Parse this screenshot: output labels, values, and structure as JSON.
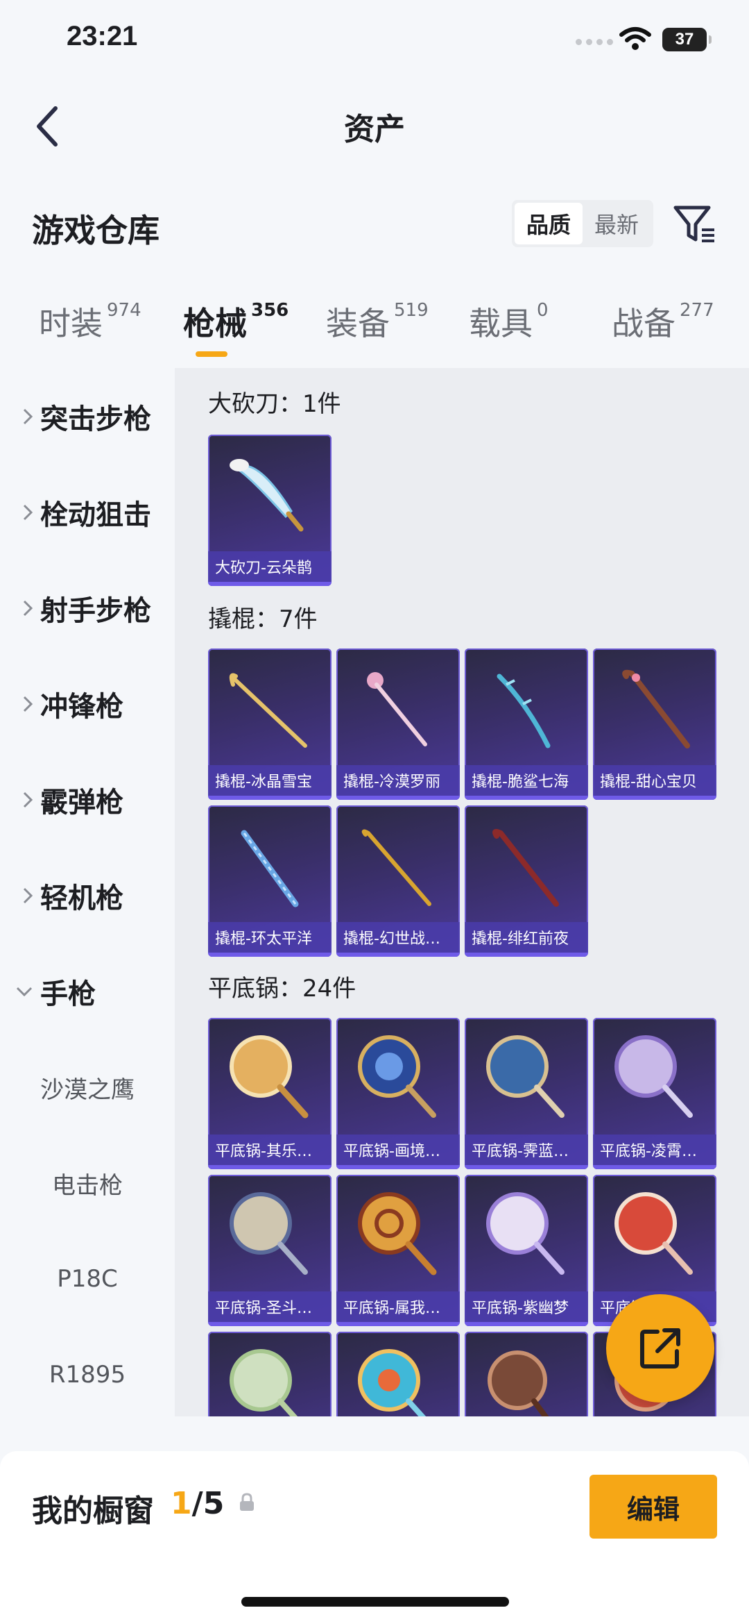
{
  "status_bar": {
    "time": "23:21",
    "battery": "37"
  },
  "header": {
    "title": "资产"
  },
  "warehouse": {
    "title": "游戏仓库",
    "sort_options": [
      "品质",
      "最新"
    ]
  },
  "tabs": [
    {
      "label": "时装",
      "count": "974"
    },
    {
      "label": "枪械",
      "count": "356"
    },
    {
      "label": "装备",
      "count": "519"
    },
    {
      "label": "载具",
      "count": "0"
    },
    {
      "label": "战备",
      "count": "277"
    }
  ],
  "sidebar": {
    "categories": [
      "突击步枪",
      "栓动狙击",
      "射手步枪",
      "冲锋枪",
      "霰弹枪",
      "轻机枪",
      "手枪"
    ],
    "sub_items": [
      "沙漠之鹰",
      "电击枪",
      "P18C",
      "R1895"
    ]
  },
  "groups": [
    {
      "title": "大砍刀：1件",
      "items": [
        "大砍刀-云朵鹊"
      ]
    },
    {
      "title": "撬棍：7件",
      "items": [
        "撬棍-冰晶雪宝",
        "撬棍-冷漠罗丽",
        "撬棍-脆鲨七海",
        "撬棍-甜心宝贝",
        "撬棍-环太平洋",
        "撬棍-幻世战…",
        "撬棍-绯红前夜"
      ]
    },
    {
      "title": "平底锅：24件",
      "items": [
        "平底锅-其乐…",
        "平底锅-画境…",
        "平底锅-霁蓝…",
        "平底锅-凌霄…",
        "平底锅-圣斗…",
        "平底锅-属我…",
        "平底锅-紫幽梦",
        "平底锅-凌…"
      ]
    }
  ],
  "bottom_bar": {
    "label": "我的橱窗",
    "current": "1",
    "total": "/5",
    "edit_label": "编辑"
  },
  "colors": {
    "accent": "#f6a716",
    "card_bg": "#3a2f6a",
    "card_label": "#4a3caa"
  }
}
